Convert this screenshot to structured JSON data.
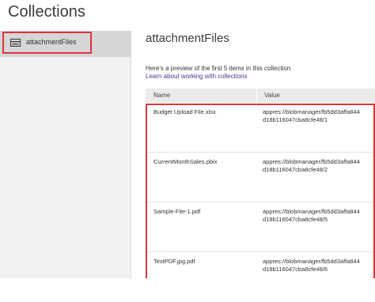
{
  "page": {
    "title": "Collections"
  },
  "sidebar": {
    "items": [
      {
        "label": "attachmentFiles",
        "icon": "table-icon",
        "selected": true
      }
    ]
  },
  "main": {
    "collection_name": "attachmentFiles",
    "preview_text": "Here's a preview of the first 5 items in this collection",
    "learn_link": "Learn about working with collections",
    "columns": [
      "Name",
      "Value"
    ],
    "rows": [
      {
        "name": "Budget Upload File.xlsx",
        "value_line1": "appres://blobmanager/fb5dd3affa844",
        "value_line2": "d18b116047cba8cfe48/1"
      },
      {
        "name": "CurrentMonthSales.pbix",
        "value_line1": "appres://blobmanager/fb5dd3affa844",
        "value_line2": "d18b116047cba8cfe48/2"
      },
      {
        "name": "Sample-File-1.pdf",
        "value_line1": "appres://blobmanager/fb5dd3affa844",
        "value_line2": "d18b116047cba8cfe48/5"
      },
      {
        "name": "TestPDF.jpg.pdf",
        "value_line1": "appres://blobmanager/fb5dd3affa844",
        "value_line2": "d18b116047cba8cfe48/6"
      }
    ]
  },
  "colors": {
    "highlight": "#d9363e",
    "link": "#5a2f8f",
    "sidebar_bg": "#f2f2f2",
    "sidebar_selected_bg": "#d6d6d6",
    "header_bg": "#ebebeb"
  }
}
